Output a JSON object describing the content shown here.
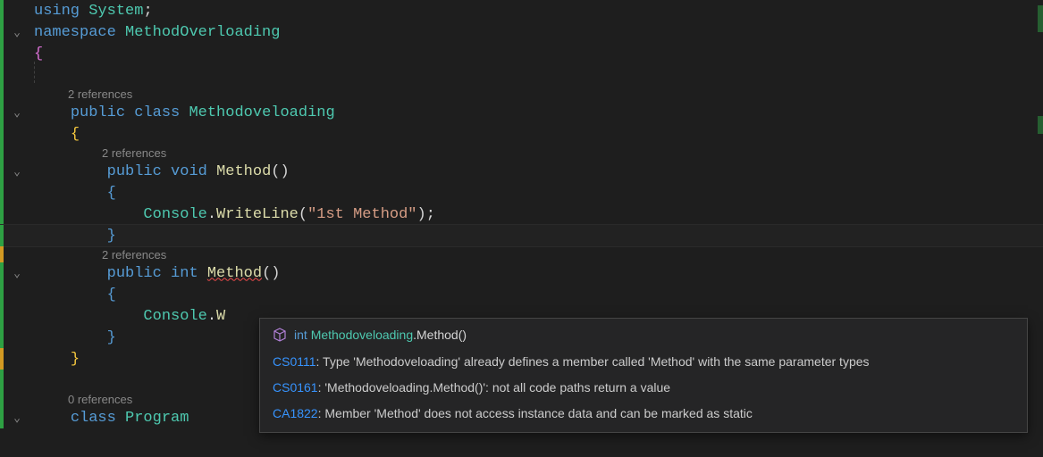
{
  "code": {
    "l1_using": "using",
    "l1_system": "System",
    "l2_namespace": "namespace",
    "l2_name": "MethodOverloading",
    "l3_brace": "{",
    "ref2": "2 references",
    "l5_public": "public",
    "l5_class": "class",
    "l5_name": "Methodoveloading",
    "l6_brace": "{",
    "l8_public": "public",
    "l8_void": "void",
    "l8_method": "Method",
    "l8_parens": "()",
    "l9_brace": "{",
    "l10_console": "Console",
    "l10_dot": ".",
    "l10_writeline": "WriteLine",
    "l10_open": "(",
    "l10_string": "\"1st Method\"",
    "l10_close": ");",
    "l11_brace": "}",
    "l13_public": "public",
    "l13_int": "int",
    "l13_method": "Method",
    "l13_parens": "()",
    "l14_brace": "{",
    "l15_console": "Console",
    "l15_dot": ".",
    "l15_wr": "W",
    "l16_brace": "}",
    "l17_brace": "}",
    "ref0": "0 references",
    "l19_class": "class",
    "l19_program": "Program"
  },
  "tooltip": {
    "sig_kw": "int",
    "sig_type": "Methodoveloading",
    "sig_method": ".Method()",
    "diag1_code": "CS0111",
    "diag1_text": ": Type 'Methodoveloading' already defines a member called 'Method' with the same parameter types",
    "diag2_code": "CS0161",
    "diag2_text": ": 'Methodoveloading.Method()': not all code paths return a value",
    "diag3_code": "CA1822",
    "diag3_text": ": Member 'Method' does not access instance data and can be marked as static"
  }
}
